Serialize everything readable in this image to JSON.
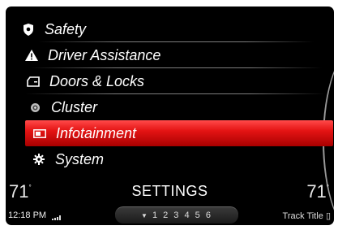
{
  "menu": {
    "items": [
      {
        "label": "Safety",
        "icon": "shield-icon"
      },
      {
        "label": "Driver Assistance",
        "icon": "warning-icon"
      },
      {
        "label": "Doors & Locks",
        "icon": "door-icon"
      },
      {
        "label": "Cluster",
        "icon": "gauge-icon"
      },
      {
        "label": "Infotainment",
        "icon": "display-icon",
        "selected": true
      },
      {
        "label": "System",
        "icon": "gear-icon"
      }
    ]
  },
  "status": {
    "temp_left": "71",
    "temp_right": "71",
    "temp_unit": "°",
    "title": "SETTINGS",
    "clock": "12:18 PM",
    "pages": "1 2 3 4 5 6",
    "track": "Track Title"
  },
  "colors": {
    "selected": "#e41414",
    "background": "#000000"
  }
}
